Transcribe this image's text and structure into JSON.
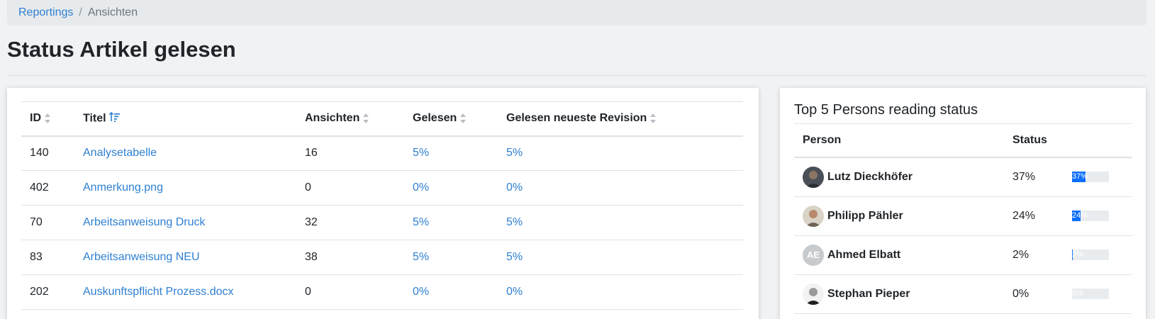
{
  "breadcrumb": {
    "parent": "Reportings",
    "separator": "/",
    "current": "Ansichten"
  },
  "page": {
    "title": "Status Artikel gelesen"
  },
  "articles_table": {
    "headers": [
      "ID",
      "Titel",
      "Ansichten",
      "Gelesen",
      "Gelesen neueste Revision"
    ],
    "rows": [
      {
        "id": "140",
        "title": "Analysetabelle",
        "views": "16",
        "read": "5%",
        "read_latest": "5%"
      },
      {
        "id": "402",
        "title": "Anmerkung.png",
        "views": "0",
        "read": "0%",
        "read_latest": "0%"
      },
      {
        "id": "70",
        "title": "Arbeitsanweisung Druck",
        "views": "32",
        "read": "5%",
        "read_latest": "5%"
      },
      {
        "id": "83",
        "title": "Arbeitsanweisung NEU",
        "views": "38",
        "read": "5%",
        "read_latest": "5%"
      },
      {
        "id": "202",
        "title": "Auskunftspflicht Prozess.docx",
        "views": "0",
        "read": "0%",
        "read_latest": "0%"
      }
    ]
  },
  "top_persons": {
    "title": "Top 5 Persons reading status",
    "headers": [
      "Person",
      "Status"
    ],
    "rows": [
      {
        "name": "Lutz Dieckhöfer",
        "status": "37%",
        "progress": 0.37,
        "avatar": "photo-dark"
      },
      {
        "name": "Philipp Pähler",
        "status": "24%",
        "progress": 0.24,
        "avatar": "photo-light"
      },
      {
        "name": "Ahmed Elbatt",
        "status": "2%",
        "progress": 0.02,
        "avatar_initials": "AE"
      },
      {
        "name": "Stephan Pieper",
        "status": "0%",
        "progress": 0.0,
        "avatar": "photo-bw"
      }
    ]
  },
  "colors": {
    "link": "#2f80d1",
    "progress_fill": "#0d6efd",
    "progress_track": "#e9ecef"
  }
}
